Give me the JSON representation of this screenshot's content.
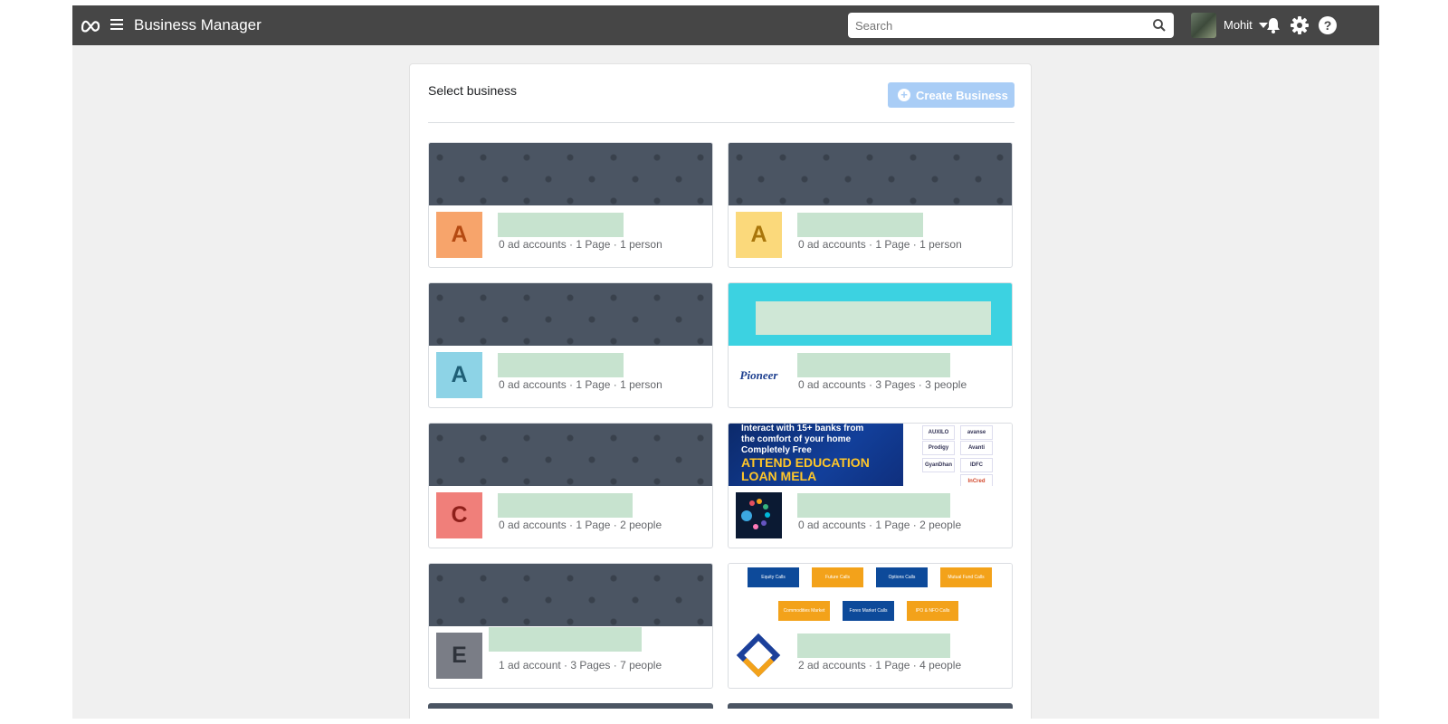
{
  "topbar": {
    "title": "Business Manager",
    "search_placeholder": "Search",
    "user_name": "Mohit"
  },
  "panel": {
    "title": "Select business",
    "create_button_label": "Create Business"
  },
  "cards": [
    {
      "logo_letter": "A",
      "logo_bg": "#f7a46b",
      "logo_fg": "#b54a12",
      "stats": "0 ad accounts · 1 Page · 1 person",
      "cover": "pattern"
    },
    {
      "logo_letter": "A",
      "logo_bg": "#fbd97b",
      "logo_fg": "#a9760b",
      "stats": "0 ad accounts · 1 Page · 1 person",
      "cover": "pattern"
    },
    {
      "logo_letter": "A",
      "logo_bg": "#8dd3e6",
      "logo_fg": "#1f5f76",
      "stats": "0 ad accounts · 1 Page · 1 person",
      "cover": "pattern"
    },
    {
      "logo_text": "Pioneer",
      "stats": "0 ad accounts · 3 Pages · 3 people",
      "cover": "teal"
    },
    {
      "logo_letter": "C",
      "logo_bg": "#f07f7a",
      "logo_fg": "#8e1f1a",
      "stats": "0 ad accounts · 1 Page · 2 people",
      "cover": "pattern"
    },
    {
      "logo_icon": "colorful-dots-logo",
      "stats": "0 ad accounts · 1 Page · 2 people",
      "cover": "loan",
      "cover_text": {
        "line1": "Interact with 15+ banks from",
        "line2": "the comfort of your home",
        "line3": "Completely Free",
        "line4": "ATTEND EDUCATION",
        "line5": "LOAN MELA"
      },
      "bank_tags": [
        "AUXILO",
        "avanse",
        "Prodigy",
        "",
        "Avanti",
        "GyanDhan",
        "IDFC",
        "InCred"
      ]
    },
    {
      "logo_letter": "E",
      "logo_bg": "#7a7d86",
      "logo_fg": "#2f333b",
      "stats": "1 ad account · 3 Pages · 7 people",
      "cover": "pattern"
    },
    {
      "logo_icon": "diamond-logo",
      "stats": "2 ad accounts · 1 Page · 4 people",
      "cover": "tiles",
      "tiles": [
        "Equity Calls",
        "Future Calls",
        "Options Calls",
        "Mutual Fund Calls",
        "Commodities Market Calls",
        "Forex Market Calls",
        "IPO & NFO Calls"
      ]
    }
  ],
  "colors": {
    "topbar_bg": "#464646",
    "accent_button": "#a9cdf6",
    "cover_dark": "#4b5563",
    "cover_teal": "#3cd2e1"
  },
  "icons": [
    "meta-logo-icon",
    "hamburger-menu-icon",
    "search-icon",
    "caret-down-icon",
    "bell-icon",
    "gear-icon",
    "help-icon",
    "plus-circle-icon"
  ]
}
